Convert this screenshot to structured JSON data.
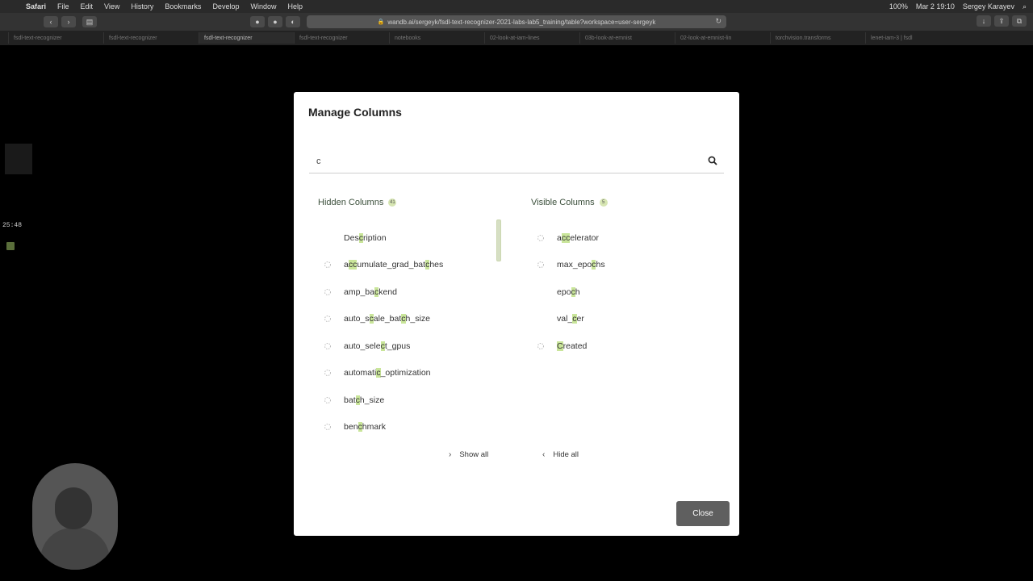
{
  "menubar": {
    "app": "Safari",
    "items": [
      "File",
      "Edit",
      "View",
      "History",
      "Bookmarks",
      "Develop",
      "Window",
      "Help"
    ],
    "battery": "100%",
    "datetime": "Mar 2 19:10",
    "user": "Sergey Karayev"
  },
  "browser": {
    "url": "wandb.ai/sergeyk/fsdl-text-recognizer-2021-labs-lab5_training/table?workspace=user-sergeyk",
    "tabs": [
      "fsdl-text-recognizer",
      "fsdl-text-recognizer",
      "fsdl-text-recognizer",
      "fsdl-text-recognizer",
      "notebooks",
      "02-look-at-iam-lines",
      "03b-look-at-emnist",
      "02-look-at-emnist-lin",
      "torchvision.transforms",
      "lenet-iam-3 | fsdl"
    ],
    "active_tab": 2
  },
  "background": {
    "timer": "25:48"
  },
  "modal": {
    "title": "Manage Columns",
    "search": {
      "value": "c",
      "icon": "search-icon"
    },
    "hidden": {
      "label": "Hidden Columns",
      "count": "41",
      "items": [
        "Description",
        "accumulate_grad_batches",
        "amp_backend",
        "auto_scale_batch_size",
        "auto_select_gpus",
        "automatic_optimization",
        "batch_size",
        "benchmark"
      ]
    },
    "visible": {
      "label": "Visible Columns",
      "count": "5",
      "items": [
        "accelerator",
        "max_epochs",
        "epoch",
        "val_cer",
        "Created"
      ]
    },
    "show_all": "Show all",
    "hide_all": "Hide all",
    "close": "Close",
    "colors": {
      "highlight": "#c9e59a",
      "header_text": "#3b4f3b",
      "close_bg": "#5f5f5f"
    }
  }
}
